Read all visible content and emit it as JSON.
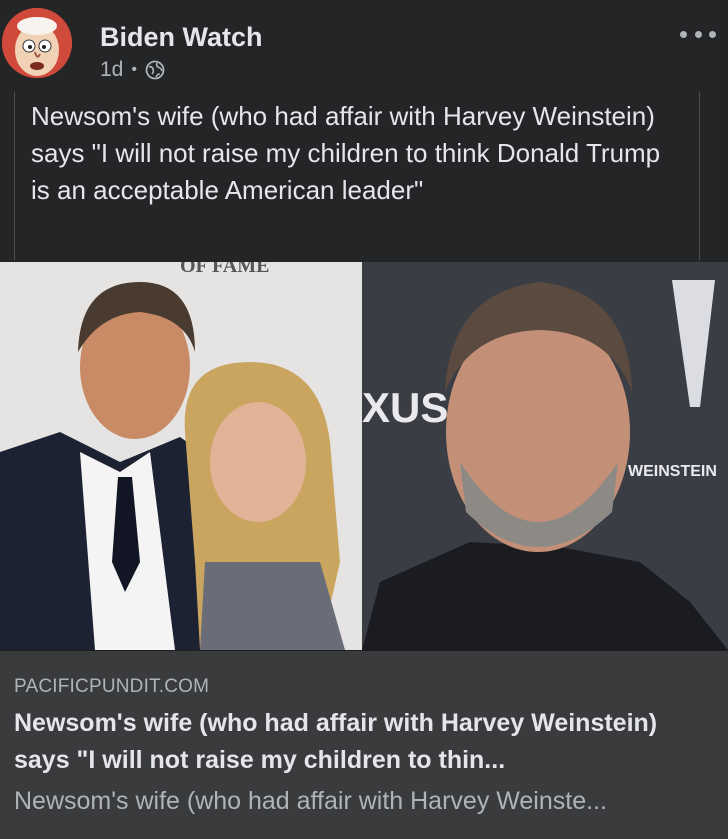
{
  "post": {
    "page_name": "Biden Watch",
    "time": "1d",
    "separator": "•",
    "privacy_icon": "globe-icon",
    "more_icon": "more-options-icon",
    "text": "Newsom's wife (who had affair with Harvey Weinstein) says \"I will not raise my children to think Donald Trump is an acceptable American leader\""
  },
  "photo": {
    "left_backdrop_text": "OF FAME",
    "right_backdrop_text_1": "XUS",
    "right_backdrop_text_2": "WEINSTEIN"
  },
  "link": {
    "domain": "PACIFICPUNDIT.COM",
    "title": "Newsom's wife (who had affair with Harvey Weinstein) says \"I will not raise my children to thin...",
    "description": "Newsom's wife (who had affair with Harvey Weinste..."
  },
  "colors": {
    "background": "#242526",
    "preview_background": "#3a3b3c",
    "primary_text": "#e4e6eb",
    "secondary_text": "#b0b3b8"
  }
}
